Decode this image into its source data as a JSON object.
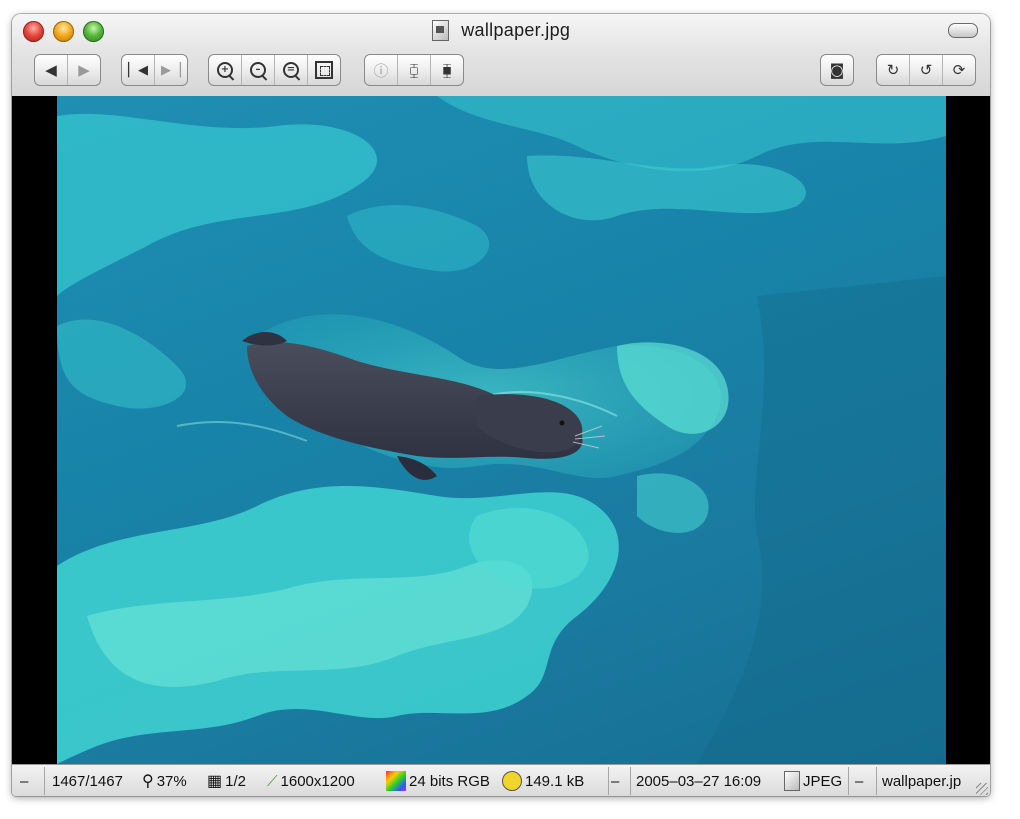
{
  "window": {
    "title": "wallpaper.jpg"
  },
  "toolbar": {
    "nav": [
      "previous",
      "next"
    ],
    "jump": [
      "first-image",
      "last-image"
    ],
    "zoom": [
      "zoom-in",
      "zoom-out",
      "zoom-actual",
      "zoom-fit"
    ],
    "view": [
      "info",
      "compare",
      "compare-alt"
    ],
    "right": [
      "screen-capture"
    ],
    "rotate": [
      "rotate-right",
      "rotate-left",
      "flip"
    ]
  },
  "status": {
    "collapse_left": "–",
    "position": "1467/1467",
    "zoom": "37%",
    "page": "1/2",
    "dimensions": "1600x1200",
    "color_depth": "24 bits RGB",
    "file_size": "149.1 kB",
    "collapse_mid": "–",
    "date": "2005–03–27 16:09",
    "format": "JPEG",
    "collapse_right": "–",
    "filename": "wallpaper.jp"
  },
  "colors": {
    "water_dark": "#166e92",
    "water_light": "#3fd2d0",
    "seal": "#3c3f4e"
  }
}
